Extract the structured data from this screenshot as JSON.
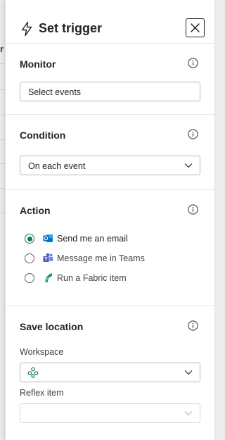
{
  "background": {
    "partial_char": "r"
  },
  "header": {
    "title": "Set trigger",
    "trigger_icon": "lightning-icon",
    "close_icon": "close-icon"
  },
  "monitor": {
    "title": "Monitor",
    "info_icon": "info-icon",
    "field_value": "Select events"
  },
  "condition": {
    "title": "Condition",
    "info_icon": "info-icon",
    "selected": "On each event"
  },
  "action": {
    "title": "Action",
    "info_icon": "info-icon",
    "options": [
      {
        "label": "Send me an email",
        "icon": "outlook-icon",
        "checked": true
      },
      {
        "label": "Message me in Teams",
        "icon": "teams-icon",
        "checked": false
      },
      {
        "label": "Run a Fabric item",
        "icon": "fabric-icon",
        "checked": false
      }
    ]
  },
  "save_location": {
    "title": "Save location",
    "info_icon": "info-icon",
    "workspace_label": "Workspace",
    "workspace_icon": "workspace-icon",
    "workspace_value": "",
    "reflex_label": "Reflex item",
    "reflex_value": ""
  },
  "colors": {
    "accent": "#117865",
    "border": "#b8b8b8",
    "text": "#242424"
  }
}
